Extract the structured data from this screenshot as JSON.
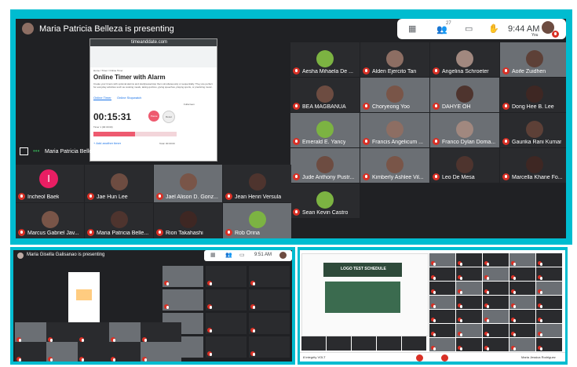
{
  "top_screen": {
    "presenter_banner": "Maria Patricia Belleza is presenting",
    "clock": "9:44 AM",
    "participant_count": "27",
    "you_label": "You",
    "presenter_name": "Maria Patricia Belleza",
    "shared_page": {
      "url": "timeanddate.com",
      "breadcrumb": "Home / Timer / Online Timer",
      "title": "Online Timer with Alarm",
      "description": "Create your timers with optional alarms and start/pause/stop them simultaneously or sequentially. They are perfect for everyday activities such as cooking meals, taking quizzes, giving speeches, playing sports, or practicing music.",
      "tab_timer": "Online Timer",
      "tab_stopwatch": "Online Stopwatch",
      "fullscreen": "Fullscreen",
      "time": "00:15:31",
      "pause_label": "Pause",
      "reset_label": "Reset",
      "timer_label": "Timer 1 (00:30:00)",
      "add_timer": "+ Add another timer",
      "total": "Total: 00:00:00",
      "progress": 0.5
    },
    "participants_right": [
      "Aesha Mihaela De ...",
      "Alden Ejercito Tan",
      "Angelina Schroeter",
      "Aoife Zuidhen",
      "BEA MAGBANUA",
      "Choryeong Yoo",
      "DAHYE OH",
      "Dong Hee B. Lee",
      "Emerald E. Yancy",
      "Francis Angelicum ...",
      "Franco Dylan Doma...",
      "Gaurika Rani Kumar",
      "Jude Anthony Pustr...",
      "Kimberly Ashlee Vil...",
      "Leo De Mesa",
      "Marcella Khane Fo...",
      "Sean Kevin Castro"
    ],
    "participants_left_row1": [
      "Incheol Baek",
      "Jae Hun Lee",
      "Jael Alison D. Gonz...",
      "Jean Henri Versula"
    ],
    "participants_left_row2": [
      "Marcus Gabriel Jav...",
      "Maria Patricia Belle...",
      "Rion Takahashi",
      "Rob Orina"
    ],
    "incheol_initial": "I"
  },
  "bottom_left_screen": {
    "presenter_banner": "Maria Gisella Galisanao is presenting",
    "clock": "9:51 AM"
  },
  "bottom_right_screen": {
    "sheet_title": "LOGO TEST SCHEDULE",
    "footer_left": "8 integrity VOLT",
    "footer_right": "Maria Jessica Rodriguez"
  },
  "colors": {
    "panel": "#00bcd0",
    "meet_bg": "#202124",
    "muted": "#d93025",
    "incheol": "#e91e63"
  }
}
